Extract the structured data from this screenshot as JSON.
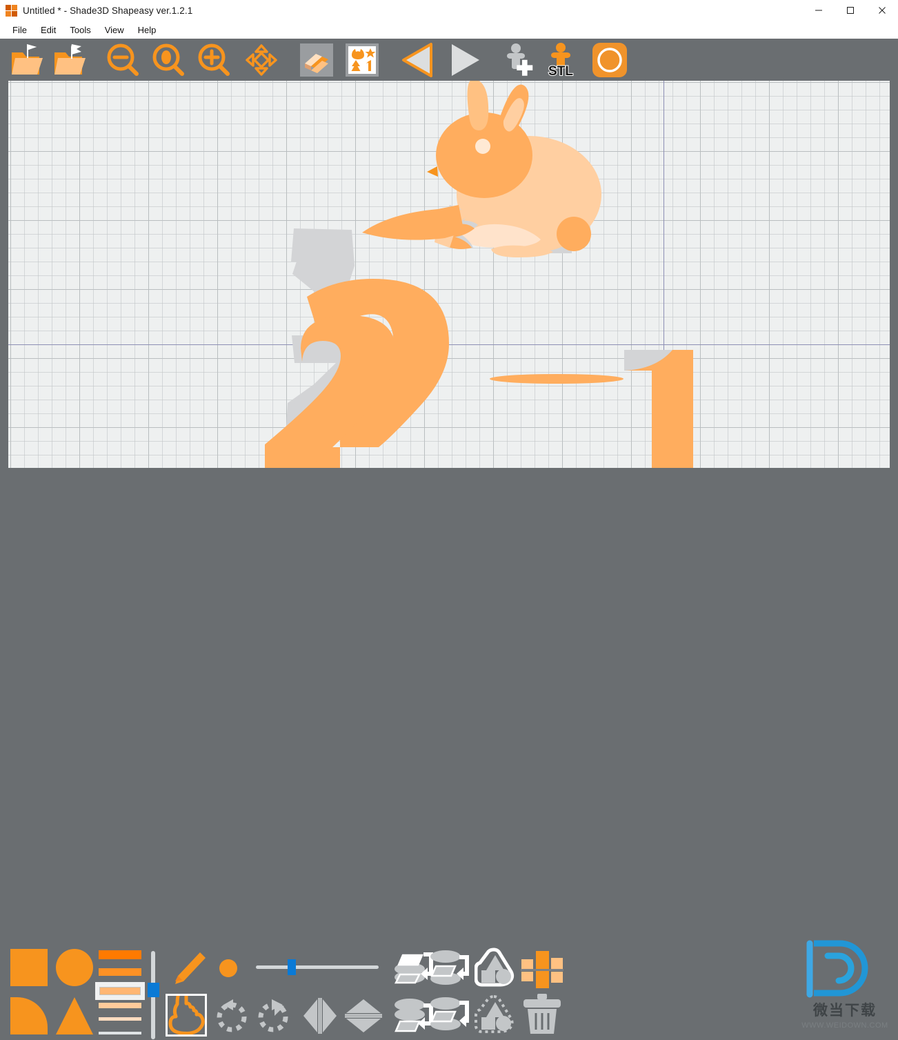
{
  "window": {
    "title": "Untitled *  - Shade3D Shapeasy ver.1.2.1",
    "app_icon": "shade3d-app-icon",
    "controls": {
      "minimize": "—",
      "maximize": "☐",
      "close": "✕"
    }
  },
  "menubar": {
    "items": [
      {
        "label": "File"
      },
      {
        "label": "Edit"
      },
      {
        "label": "Tools"
      },
      {
        "label": "View"
      },
      {
        "label": "Help"
      }
    ]
  },
  "toolbar": {
    "items": [
      {
        "name": "open-file-button",
        "tooltip": "Open",
        "icon": "folder-open-icon"
      },
      {
        "name": "save-file-button",
        "tooltip": "Save",
        "icon": "folder-save-icon"
      },
      {
        "name": "zoom-out-button",
        "tooltip": "Zoom Out",
        "icon": "magnifier-minus-icon"
      },
      {
        "name": "zoom-fit-button",
        "tooltip": "Zoom Fit",
        "icon": "magnifier-oval-icon"
      },
      {
        "name": "zoom-in-button",
        "tooltip": "Zoom In",
        "icon": "magnifier-plus-icon"
      },
      {
        "name": "pan-button",
        "tooltip": "Pan",
        "icon": "four-arrows-move-icon"
      },
      {
        "name": "layers-button",
        "tooltip": "Layers",
        "icon": "three-d-layers-icon"
      },
      {
        "name": "stamp-library-button",
        "tooltip": "Stamp Library",
        "icon": "stamp-library-icon"
      },
      {
        "name": "previous-button",
        "tooltip": "Previous",
        "icon": "triangle-left-icon"
      },
      {
        "name": "next-button",
        "tooltip": "Next",
        "icon": "triangle-right-icon"
      },
      {
        "name": "add-figure-button",
        "tooltip": "Add Figure",
        "icon": "person-plus-icon"
      },
      {
        "name": "export-stl-button",
        "tooltip": "Export STL",
        "icon": "person-stl-icon",
        "label": "STL"
      },
      {
        "name": "render-button",
        "tooltip": "3D Preview",
        "icon": "sphere-render-icon"
      }
    ]
  },
  "canvas": {
    "name": "drawing-canvas",
    "grid": "on",
    "background_color": "#eef0f0",
    "grid_minor_color": "#bec2c4",
    "grid_major_color": "#a0a5a8",
    "axis_color": "#8d8fb5",
    "objects": [
      {
        "name": "rabbit-shape",
        "label": "Rabbit"
      },
      {
        "name": "carrot-shape",
        "label": "Carrot"
      },
      {
        "name": "number-two-shape",
        "label": "2"
      },
      {
        "name": "number-one-shape",
        "label": "1"
      },
      {
        "name": "ellipse-shape",
        "label": "Ellipse"
      }
    ],
    "colors": {
      "orange_light": "#ffad5e",
      "orange_pale": "#ffcfa1",
      "orange_palest": "#ffe3cb",
      "orange_accent": "#f7941e",
      "shadow_grey": "#d3d4d6"
    }
  },
  "bottombar": {
    "shapes": [
      {
        "name": "tool-square",
        "label": "Square"
      },
      {
        "name": "tool-circle",
        "label": "Circle"
      },
      {
        "name": "tool-quarter-circle",
        "label": "Quarter Circle"
      },
      {
        "name": "tool-triangle",
        "label": "Triangle"
      }
    ],
    "shade_selector": {
      "name": "shade-selector",
      "selected_index": 2,
      "levels": [
        "#ff7a00",
        "#ff9124",
        "#ffb673",
        "#ffcb9b",
        "#ffdcc0",
        "#dfe3e5"
      ]
    },
    "vertical_slider": {
      "name": "height-slider",
      "value": 36
    },
    "horizontal_slider": {
      "name": "size-slider",
      "value": 26
    },
    "tools": [
      {
        "name": "tool-pencil",
        "label": "Pencil",
        "selected": false
      },
      {
        "name": "tool-dot",
        "label": "Dot",
        "selected": false
      },
      {
        "name": "tool-pointer-hand",
        "label": "Select",
        "selected": true
      },
      {
        "name": "tool-rotate-ccw",
        "label": "Rotate Left",
        "selected": false
      },
      {
        "name": "tool-rotate-cw",
        "label": "Rotate Right",
        "selected": false
      },
      {
        "name": "tool-flip-horizontal",
        "label": "Flip Horizontal",
        "selected": false
      },
      {
        "name": "tool-flip-vertical",
        "label": "Flip Vertical",
        "selected": false
      },
      {
        "name": "tool-bring-to-front",
        "label": "Bring To Front",
        "selected": false
      },
      {
        "name": "tool-bring-forward",
        "label": "Bring Forward",
        "selected": false
      },
      {
        "name": "tool-send-backward",
        "label": "Send Backward",
        "selected": false
      },
      {
        "name": "tool-send-to-back",
        "label": "Send To Back",
        "selected": false
      },
      {
        "name": "tool-group",
        "label": "Group",
        "selected": false
      },
      {
        "name": "tool-ungroup",
        "label": "Ungroup",
        "selected": false
      },
      {
        "name": "tool-align-grid",
        "label": "Align",
        "selected": false
      },
      {
        "name": "tool-delete",
        "label": "Delete",
        "selected": false
      }
    ]
  },
  "watermark": {
    "chinese": "微当下载",
    "url": "WWW.WEIDOWN.COM",
    "logo": "d-letter-logo",
    "color": "#29a3e0"
  }
}
